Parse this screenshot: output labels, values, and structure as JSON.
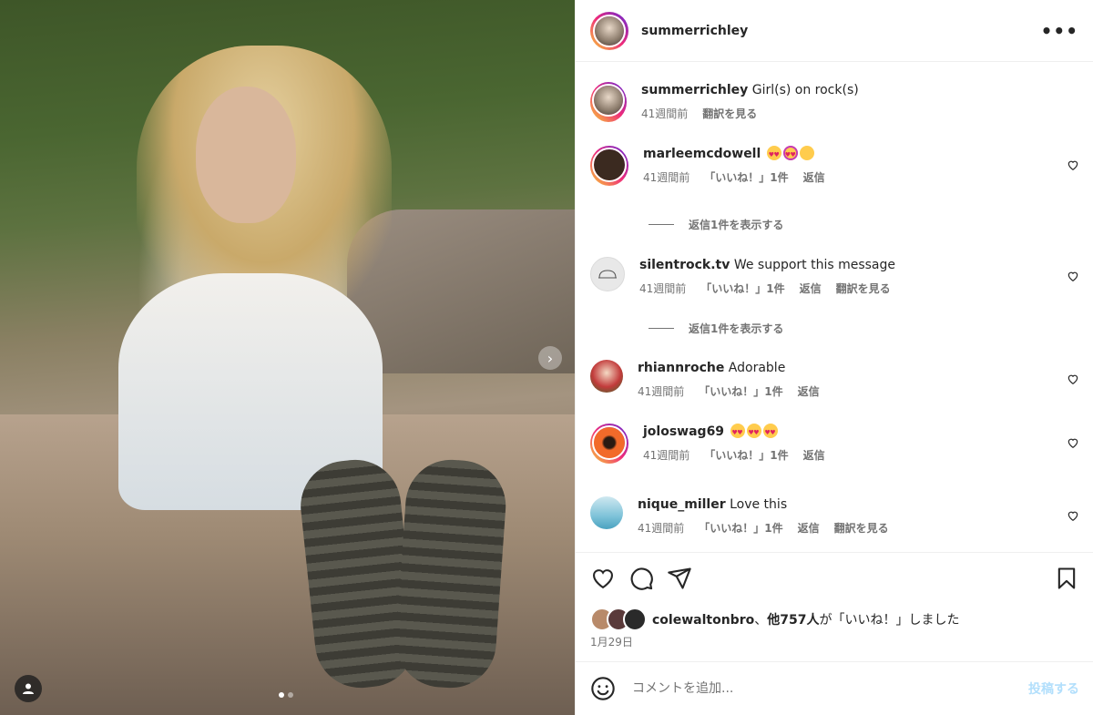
{
  "post": {
    "author": "summerrichley",
    "more_icon": "more-horizontal-icon",
    "carousel": {
      "next_icon": "chevron-right-icon",
      "slide_count": 2,
      "active_slide": 1
    },
    "tag_icon": "user-tag-icon"
  },
  "caption": {
    "username": "summerrichley",
    "text": "Girl(s) on rock(s)",
    "time": "41週間前",
    "translate": "翻訳を見る"
  },
  "comments": [
    {
      "username": "marleemcdowell",
      "text": "",
      "emojis": [
        "heart-eyes",
        "heart-eyes-purple",
        "blush"
      ],
      "time": "41週間前",
      "likes": "「いいね！」1件",
      "reply": "返信",
      "translate": "",
      "view_replies": "返信1件を表示する",
      "avatar_color": "#3b2a20",
      "story_ring": true
    },
    {
      "username": "silentrock.tv",
      "text": "We support this message",
      "emojis": [],
      "time": "41週間前",
      "likes": "「いいね！」1件",
      "reply": "返信",
      "translate": "翻訳を見る",
      "view_replies": "返信1件を表示する",
      "avatar_color": "#e8e8e8",
      "story_ring": false
    },
    {
      "username": "rhiannroche",
      "text": "Adorable",
      "emojis": [],
      "time": "41週間前",
      "likes": "「いいね！」1件",
      "reply": "返信",
      "translate": "",
      "view_replies": "",
      "avatar_color": "#c23b3b",
      "story_ring": false
    },
    {
      "username": "joloswag69",
      "text": "",
      "emojis": [
        "heart-eyes",
        "heart-eyes",
        "heart-eyes"
      ],
      "time": "41週間前",
      "likes": "「いいね！」1件",
      "reply": "返信",
      "translate": "",
      "view_replies": "",
      "avatar_color": "#f26a2a",
      "story_ring": true
    },
    {
      "username": "nique_miller",
      "text": "Love this",
      "emojis": [],
      "time": "41週間前",
      "likes": "「いいね！」1件",
      "reply": "返信",
      "translate": "翻訳を見る",
      "view_replies": "",
      "avatar_color": "#7fc3d9",
      "story_ring": false
    }
  ],
  "actions": {
    "like_icon": "heart-outline-icon",
    "comment_icon": "comment-icon",
    "share_icon": "send-icon",
    "save_icon": "bookmark-icon"
  },
  "likes": {
    "first_user": "colewaltonbro",
    "others": "他757人",
    "suffix_ga": "が",
    "suffix": "「いいね！」しました",
    "separator": "、"
  },
  "date": "1月29日",
  "add_comment": {
    "placeholder": "コメントを追加...",
    "post_label": "投稿する",
    "emoji_icon": "smiley-icon"
  }
}
